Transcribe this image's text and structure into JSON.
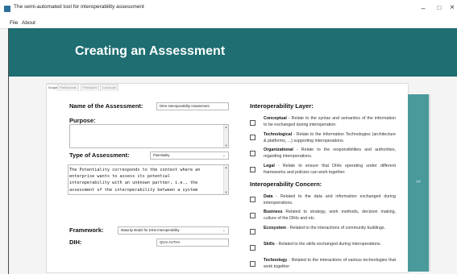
{
  "window": {
    "title": "The semi-automated tool for interoperability assessment",
    "controls": {
      "minimize": "–",
      "maximize": "□",
      "close": "×"
    }
  },
  "menu": [
    "File",
    "About"
  ],
  "banner": {
    "title": "Creating an Assessment",
    "color": "#1e6e72"
  },
  "tabs": [
    "Scope",
    "Participants",
    "Principles",
    "Conclude"
  ],
  "form": {
    "name_label": "Name of the Assessment:",
    "name_value": "DIHs Interoperability Assessment",
    "purpose_label": "Purpose:",
    "purpose_value": "",
    "type_label": "Type of Assessment:",
    "type_value": "Potentiality",
    "type_description": "The Potentiality corresponds to the context where an\nenterprise wants to assess its potential\ninteroperability with an unknown partner, i.e., the\nassessment of the interoperability between a system",
    "framework_label": "Framework:",
    "framework_value": "Maturity Model for DIHs Interoperability",
    "dih_label": "DIH:",
    "dih_value": "QUAI AUTHA"
  },
  "layers": {
    "title": "Interoperability Layer:",
    "items": [
      {
        "name": "Conceptual",
        "text": " - Relate to the syntax and semantics of the information to be exchanged during interoperation."
      },
      {
        "name": "Technological",
        "text": " - Relate to the Information Technologies (architecture & platforms, ...) supporting interoperations."
      },
      {
        "name": "Organizational",
        "text": " - Relate to the responsibilities and authorities, regarding interoperations."
      },
      {
        "name": "Legal",
        "text": " - Relate to ensure that DIHs operating under different frameworks and policies can work together."
      }
    ]
  },
  "concerns": {
    "title": "Interoperability Concern:",
    "items": [
      {
        "name": "Data",
        "text": " - Related to the data and information exchanged during interoperations."
      },
      {
        "name": "Business",
        "text": " Related to strategy, work methods, decision making, culture of the DIHs and etc."
      },
      {
        "name": "Ecosystem",
        "text": " - Related to the interactions of community buildings."
      },
      {
        "name": "Skills",
        "text": " - Related to the skills exchanged during interoperations."
      },
      {
        "name": "Technology",
        "text": " - Related to the interactions of various technologies that work together"
      }
    ]
  },
  "next_button": {
    "label": ">>",
    "color": "#4a9a9c"
  }
}
